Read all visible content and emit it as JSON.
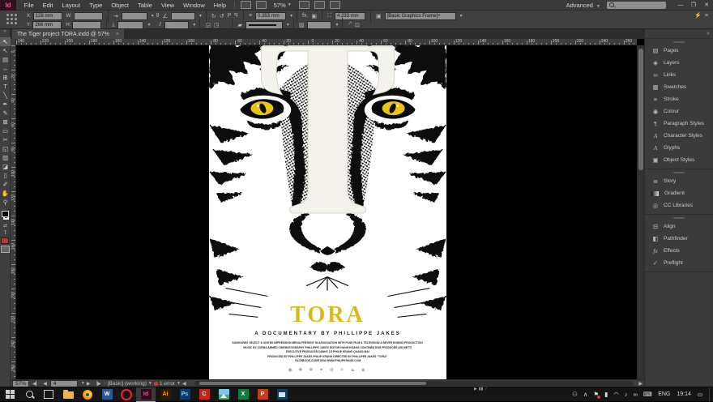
{
  "app": {
    "logo": "Id",
    "zoom": "57%",
    "workspace": "Advanced"
  },
  "menubar": {
    "items": [
      "File",
      "Edit",
      "Layout",
      "Type",
      "Object",
      "Table",
      "View",
      "Window",
      "Help"
    ]
  },
  "control": {
    "x_label": "X:",
    "x": "128 mm",
    "y_label": "Y:",
    "y": "266 mm",
    "w_label": "W:",
    "w": "",
    "h_label": "H:",
    "h": "",
    "link_glyph": "8",
    "angle_glyph": "∠",
    "shear_glyph": "⫽",
    "rotate_cw": "↻",
    "rotate_ccw": "↺",
    "flip_label": "P",
    "stroke_weight": "0.353 mm",
    "fx_label": "fx.",
    "corner_radius": "4.233 mm",
    "object_style": "[Basic Graphics Frame]+",
    "lightning": "⚡"
  },
  "tab": {
    "title": "The Tiger project TORA.indd @ 57%",
    "close": "×"
  },
  "rulers": {
    "h_labels": [
      "240",
      "220",
      "200",
      "180",
      "160",
      "140",
      "120",
      "100",
      "80",
      "60",
      "40",
      "20",
      "0",
      "20",
      "40",
      "60",
      "80",
      "100",
      "120",
      "140",
      "160",
      "180",
      "200",
      "220",
      "240",
      "260"
    ],
    "v_labels": [
      "0",
      "20",
      "40",
      "60",
      "80",
      "100",
      "120",
      "140",
      "160",
      "180",
      "200",
      "220",
      "240",
      "260"
    ]
  },
  "tools": [
    {
      "name": "selection-tool",
      "glyph": "↖",
      "active": true
    },
    {
      "name": "direct-selection-tool",
      "glyph": "↖",
      "active": false
    },
    {
      "name": "page-tool",
      "glyph": "▤",
      "active": false
    },
    {
      "name": "gap-tool",
      "glyph": "↔",
      "active": false
    },
    {
      "name": "content-collector-tool",
      "glyph": "⊞",
      "active": false
    },
    {
      "name": "type-tool",
      "glyph": "T",
      "active": false
    },
    {
      "name": "line-tool",
      "glyph": "╲",
      "active": false
    },
    {
      "name": "pen-tool",
      "glyph": "✒",
      "active": false
    },
    {
      "name": "pencil-tool",
      "glyph": "✎",
      "active": false
    },
    {
      "name": "rectangle-frame-tool",
      "glyph": "⊠",
      "active": false
    },
    {
      "name": "rectangle-tool",
      "glyph": "▭",
      "active": false
    },
    {
      "name": "scissors-tool",
      "glyph": "✂",
      "active": false
    },
    {
      "name": "free-transform-tool",
      "glyph": "◱",
      "active": false
    },
    {
      "name": "gradient-swatch-tool",
      "glyph": "▥",
      "active": false
    },
    {
      "name": "gradient-feather-tool",
      "glyph": "◪",
      "active": false
    },
    {
      "name": "note-tool",
      "glyph": "▯",
      "active": false
    },
    {
      "name": "eyedropper-tool",
      "glyph": "✐",
      "active": false
    },
    {
      "name": "hand-tool",
      "glyph": "✋",
      "active": false
    },
    {
      "name": "zoom-tool",
      "glyph": "⚲",
      "active": false
    }
  ],
  "dock": {
    "collapse_glyph": "»",
    "groups": [
      [
        {
          "name": "pages-panel",
          "icon": "▤",
          "label": "Pages"
        },
        {
          "name": "layers-panel",
          "icon": "◈",
          "label": "Layers"
        },
        {
          "name": "links-panel",
          "icon": "∞",
          "label": "Links"
        },
        {
          "name": "swatches-panel",
          "icon": "▦",
          "label": "Swatches"
        },
        {
          "name": "stroke-panel",
          "icon": "≡",
          "label": "Stroke"
        },
        {
          "name": "colour-panel",
          "icon": "◉",
          "label": "Colour"
        },
        {
          "name": "paragraph-styles-panel",
          "icon": "¶",
          "label": "Paragraph Styles"
        },
        {
          "name": "character-styles-panel",
          "icon": "A",
          "label": "Character Styles",
          "italic": true
        },
        {
          "name": "glyphs-panel",
          "icon": "A",
          "label": "Glyphs",
          "italic": true
        },
        {
          "name": "object-styles-panel",
          "icon": "▣",
          "label": "Object Styles"
        }
      ],
      [
        {
          "name": "story-panel",
          "icon": "≣",
          "label": "Story"
        },
        {
          "name": "gradient-panel",
          "icon": "",
          "label": "Gradient",
          "gradicon": true
        },
        {
          "name": "cc-libraries-panel",
          "icon": "◎",
          "label": "CC Libraries"
        }
      ],
      [
        {
          "name": "align-panel",
          "icon": "⊟",
          "label": "Align"
        },
        {
          "name": "pathfinder-panel",
          "icon": "◧",
          "label": "Pathfinder"
        },
        {
          "name": "effects-panel",
          "icon": "fx",
          "label": "Effects",
          "italic": true
        },
        {
          "name": "preflight-panel",
          "icon": "✓",
          "label": "Preflight"
        }
      ]
    ]
  },
  "poster": {
    "title": "TORA",
    "title_color": "#deb912",
    "eye_color": "#e9c414",
    "subtitle": "A DOCUMENTARY BY PHILLIPPE JAKES",
    "credits": [
      "SANGUINES SELECT & UNITED IMPRESSION MEDIA PRESENT IN ASSOCIATION WITH FUSE FILM & TELEVISION  A NEVER ENDING PRODUCTION",
      "MUSIC BY ZORHA AHMED   CINEMATOGRAPHY PHILLIPPE JAKES   EDITOR HANH HOANG   CONTRIBUTING PRODUCER ARI METTI",
      "EXECUTIVE PRODUCER DANNY LE   PHILIP KRANG   QUANG MAI",
      "PRODUCED BY PHILLIPPE JAKES   PHILIP KRANG    DIRECTED BY PHILLIPPE JAKES   “TORA”",
      "FACEBOOK.COM/TORA   WWW.PHILIPKRANG.COM"
    ],
    "logos": "◉ ✚ ❖ ✦ ⊕ ✕ ▲ ◈"
  },
  "statusbar": {
    "zoom": "57%",
    "page": "4",
    "nav_first": "◀▏",
    "nav_prev": "◀",
    "nav_next": "▶",
    "nav_last": "▕▶",
    "preflight_profile": "[Basic] (working)",
    "error_text": "1 error"
  },
  "taskbar": {
    "apps": [
      {
        "name": "start-button",
        "type": "start"
      },
      {
        "name": "search-button",
        "type": "search"
      },
      {
        "name": "task-view-button",
        "type": "taskview"
      },
      {
        "name": "file-explorer",
        "type": "folder"
      },
      {
        "name": "firefox",
        "type": "firefox"
      },
      {
        "name": "word",
        "type": "tile",
        "bg": "#2b579a",
        "fg": "#ffffff",
        "label": "W"
      },
      {
        "name": "opera",
        "type": "ring"
      },
      {
        "name": "indesign",
        "type": "tile",
        "bg": "#2d0b1e",
        "fg": "#ff4e9b",
        "label": "Id",
        "active": true
      },
      {
        "name": "illustrator",
        "type": "tile",
        "bg": "#2f1c00",
        "fg": "#ff9a00",
        "label": "Ai"
      },
      {
        "name": "photoshop",
        "type": "tile",
        "bg": "#0d3a66",
        "fg": "#8fd0ff",
        "label": "Ps"
      },
      {
        "name": "creative-cloud",
        "type": "tile",
        "bg": "#c5261c",
        "fg": "#ffffff",
        "label": "C"
      },
      {
        "name": "photos",
        "type": "photo"
      },
      {
        "name": "excel",
        "type": "tile",
        "bg": "#107c41",
        "fg": "#ffffff",
        "label": "X"
      },
      {
        "name": "powerpoint",
        "type": "tile",
        "bg": "#c43e1c",
        "fg": "#ffffff",
        "label": "P"
      },
      {
        "name": "gallery",
        "type": "gallery"
      }
    ],
    "tray": {
      "icons": [
        {
          "name": "people-icon",
          "glyph": "⚇"
        },
        {
          "name": "chevron-up-icon",
          "glyph": "∧"
        },
        {
          "name": "defender-flag-icon",
          "glyph": "⚑",
          "badge": true
        },
        {
          "name": "battery-icon",
          "glyph": "▮"
        },
        {
          "name": "network-icon",
          "glyph": "◠"
        },
        {
          "name": "volume-icon",
          "glyph": "♪"
        },
        {
          "name": "link-icon",
          "glyph": "∞"
        },
        {
          "name": "keyboard-icon",
          "glyph": "⌨"
        }
      ],
      "lang": "ENG",
      "time": "19:14",
      "action_center": "▭"
    }
  }
}
